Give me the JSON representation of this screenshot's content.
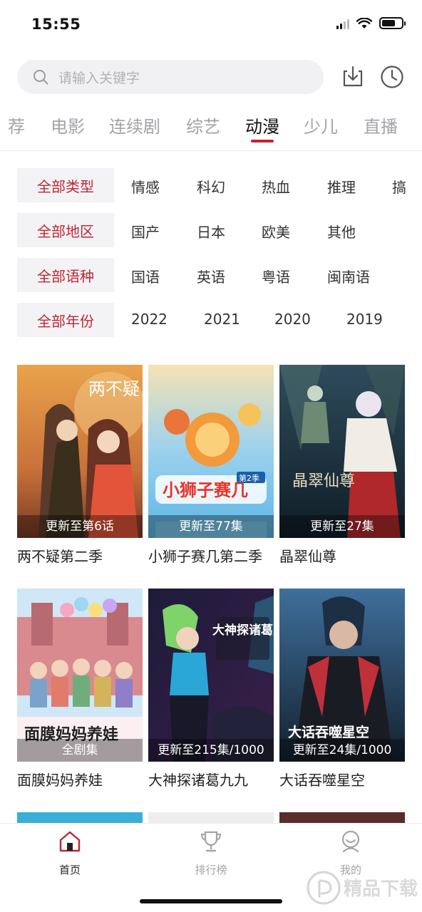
{
  "status_bar": {
    "time": "15:55",
    "battery_level": 0.7
  },
  "search": {
    "placeholder": "请输入关键字"
  },
  "tabs": [
    {
      "label": "荐",
      "active": false
    },
    {
      "label": "电影",
      "active": false
    },
    {
      "label": "连续剧",
      "active": false
    },
    {
      "label": "综艺",
      "active": false
    },
    {
      "label": "动漫",
      "active": true
    },
    {
      "label": "少儿",
      "active": false
    },
    {
      "label": "直播",
      "active": false
    }
  ],
  "filters": [
    {
      "selected": "全部类型",
      "options": [
        "情感",
        "科幻",
        "热血",
        "推理",
        "搞"
      ]
    },
    {
      "selected": "全部地区",
      "options": [
        "国产",
        "日本",
        "欧美",
        "其他"
      ]
    },
    {
      "selected": "全部语种",
      "options": [
        "国语",
        "英语",
        "粤语",
        "闽南语"
      ]
    },
    {
      "selected": "全部年份",
      "options": [
        "2022",
        "2021",
        "2020",
        "2019"
      ]
    }
  ],
  "items": [
    {
      "title": "两不疑第二季",
      "update": "更新至第6话",
      "poster_text": "两不疑"
    },
    {
      "title": "小狮子赛几第二季",
      "update": "更新至77集",
      "poster_text": "小狮子赛几",
      "poster_badge": "第2季"
    },
    {
      "title": "晶翠仙尊",
      "update": "更新至27集",
      "poster_text": "晶翠仙尊"
    },
    {
      "title": "面膜妈妈养娃",
      "update": "全剧集",
      "poster_text": "面膜妈妈养娃"
    },
    {
      "title": "大神探诸葛九九",
      "update": "更新至215集/1000",
      "poster_text": "大神探诸葛九九"
    },
    {
      "title": "大话吞噬星空",
      "update": "更新至24集/1000",
      "poster_text": "大话吞噬星空"
    }
  ],
  "bottom_nav": [
    {
      "label": "首页",
      "icon": "home-icon",
      "active": true
    },
    {
      "label": "排行榜",
      "icon": "trophy-icon",
      "active": false
    },
    {
      "label": "我的",
      "icon": "profile-icon",
      "active": false
    }
  ],
  "colors": {
    "accent": "#c02633",
    "inactive": "#a3a3a8"
  },
  "watermark": {
    "text": "精品下载"
  }
}
